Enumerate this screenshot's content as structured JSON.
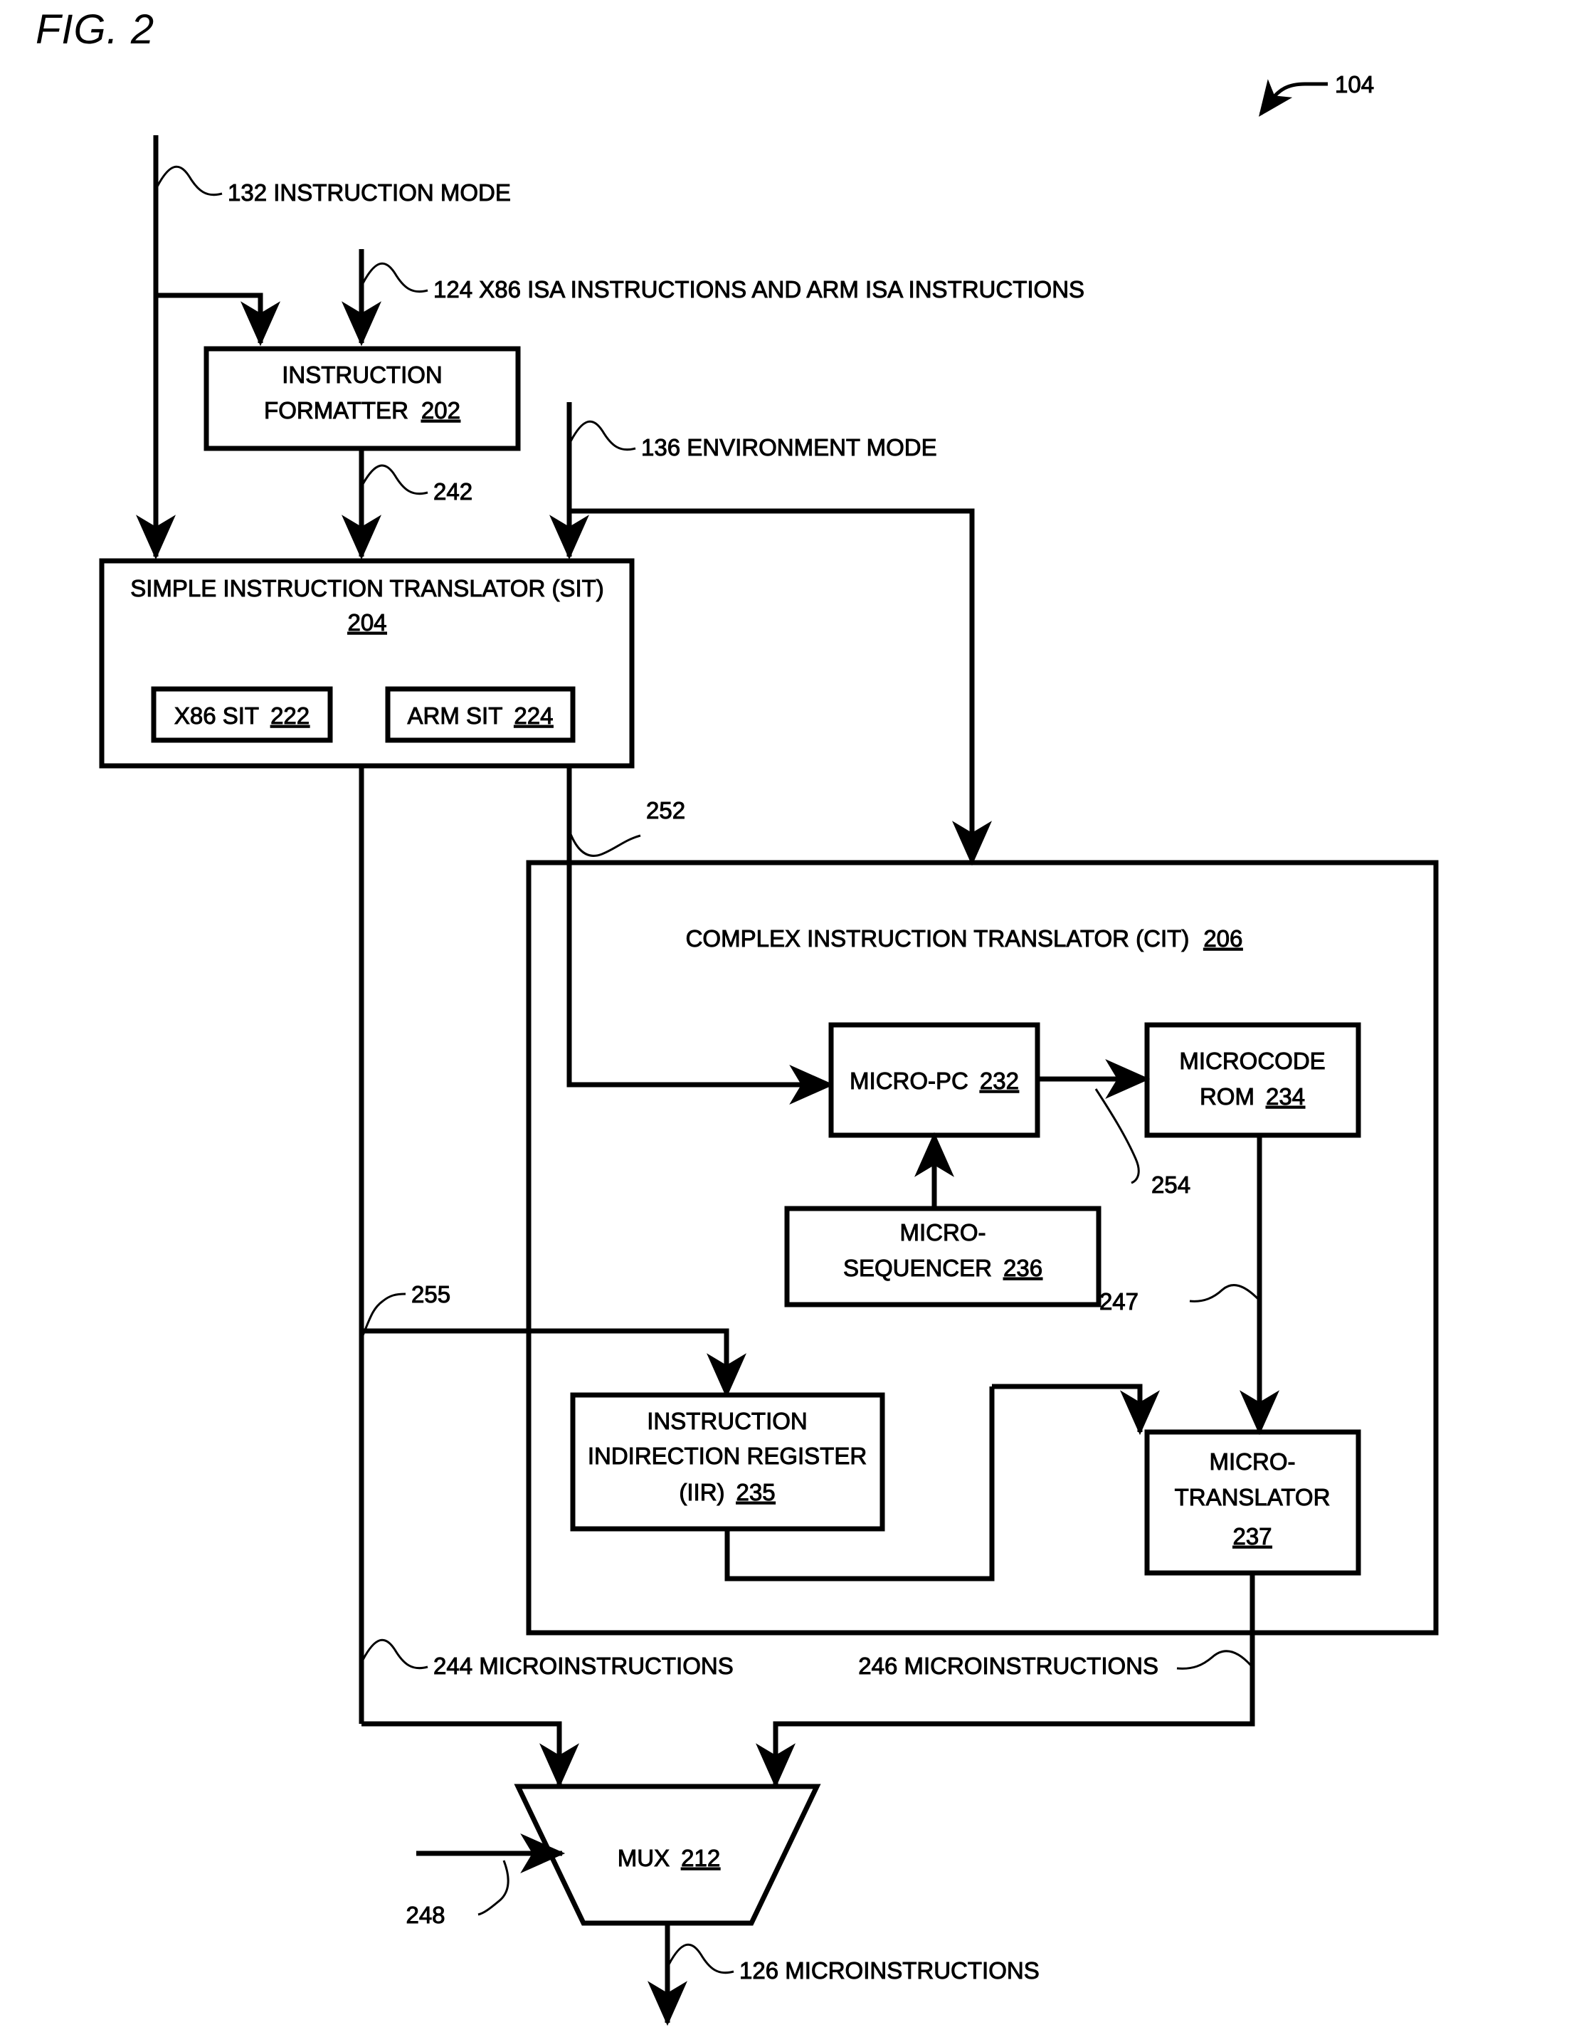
{
  "figure": {
    "label": "FIG. 2",
    "top_reference": "104"
  },
  "blocks": [
    {
      "id": "instruction-formatter",
      "line1": "INSTRUCTION",
      "line2": "FORMATTER",
      "ref": "202"
    },
    {
      "id": "simple-instruction-translator",
      "line1": "SIMPLE INSTRUCTION TRANSLATOR (SIT)",
      "line2": "",
      "ref": "204"
    },
    {
      "id": "x86-sit",
      "line1": "X86 SIT",
      "line2": "",
      "ref": "222"
    },
    {
      "id": "arm-sit",
      "line1": "ARM SIT",
      "line2": "",
      "ref": "224"
    },
    {
      "id": "complex-instruction-translator",
      "line1": "COMPLEX INSTRUCTION TRANSLATOR (CIT)",
      "line2": "",
      "ref": "206"
    },
    {
      "id": "micro-pc",
      "line1": "MICRO-PC",
      "line2": "",
      "ref": "232"
    },
    {
      "id": "microcode-rom",
      "line1": "MICROCODE",
      "line2": "ROM",
      "ref": "234"
    },
    {
      "id": "micro-sequencer",
      "line1": "MICRO-",
      "line2": "SEQUENCER",
      "ref": "236"
    },
    {
      "id": "instruction-indirection-register",
      "line1": "INSTRUCTION",
      "line2": "INDIRECTION REGISTER",
      "line3": "(IIR)",
      "ref": "235"
    },
    {
      "id": "micro-translator",
      "line1": "MICRO-",
      "line2": "TRANSLATOR",
      "ref": "237"
    },
    {
      "id": "mux",
      "line1": "MUX",
      "line2": "",
      "ref": "212"
    }
  ],
  "signals": {
    "instruction_mode": "132 INSTRUCTION MODE",
    "isa_instructions": "124 X86 ISA INSTRUCTIONS AND ARM ISA INSTRUCTIONS",
    "environment_mode": "136 ENVIRONMENT MODE",
    "ref_242": "242",
    "ref_252": "252",
    "ref_254": "254",
    "ref_255": "255",
    "ref_247": "247",
    "ref_248": "248",
    "microinstructions_244": "244 MICROINSTRUCTIONS",
    "microinstructions_246": "246 MICROINSTRUCTIONS",
    "microinstructions_126": "126 MICROINSTRUCTIONS"
  },
  "style": {
    "stroke": "#000000",
    "background": "#ffffff"
  }
}
